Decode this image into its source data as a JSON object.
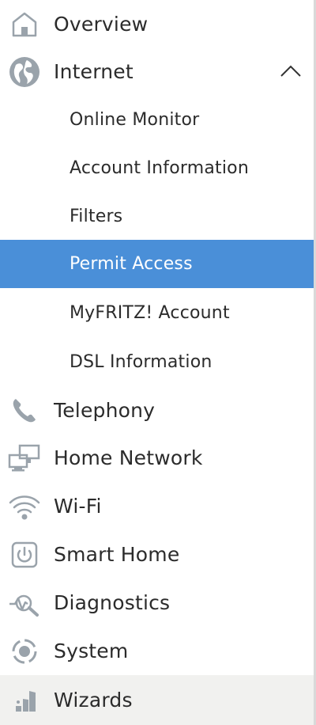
{
  "nav": {
    "overview": {
      "label": "Overview",
      "icon": "home-icon"
    },
    "internet": {
      "label": "Internet",
      "icon": "globe-icon",
      "expanded": true,
      "children": [
        {
          "label": "Online Monitor"
        },
        {
          "label": "Account Information"
        },
        {
          "label": "Filters"
        },
        {
          "label": "Permit Access",
          "active": true
        },
        {
          "label": "MyFRITZ! Account"
        },
        {
          "label": "DSL Information"
        }
      ]
    },
    "telephony": {
      "label": "Telephony",
      "icon": "phone-icon"
    },
    "home_network": {
      "label": "Home Network",
      "icon": "network-icon"
    },
    "wifi": {
      "label": "Wi-Fi",
      "icon": "wifi-icon"
    },
    "smart_home": {
      "label": "Smart Home",
      "icon": "power-icon"
    },
    "diagnostics": {
      "label": "Diagnostics",
      "icon": "diagnostics-icon"
    },
    "system": {
      "label": "System",
      "icon": "system-icon"
    },
    "wizards": {
      "label": "Wizards",
      "icon": "wizard-icon"
    }
  },
  "colors": {
    "active_background": "#4a8fd8",
    "icon_gray": "#9aa3ab",
    "wizards_background": "#f1f1ef"
  }
}
